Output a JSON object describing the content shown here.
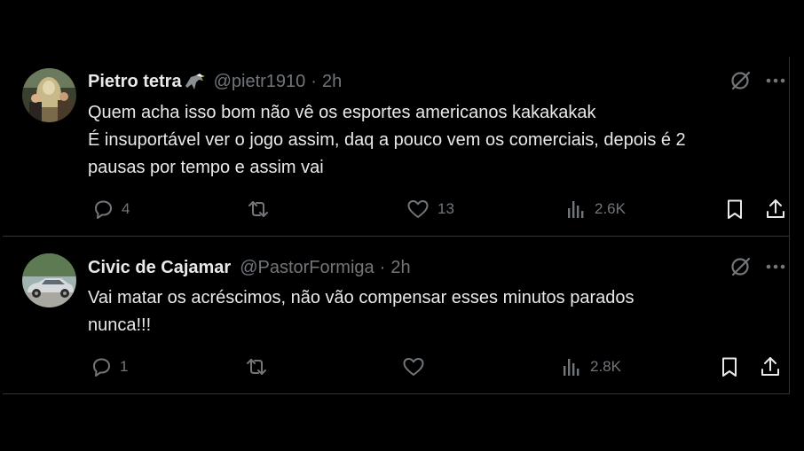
{
  "tweets": [
    {
      "display_name": "Pietro tetra",
      "name_emoji": "eagle-emoji",
      "handle": "@pietr1910",
      "separator": "·",
      "time": "2h",
      "text_lines": [
        "Quem acha isso bom não vê os esportes americanos kakakakak",
        "É insuportável ver o jogo assim, daq a pouco vem os comerciais, depois é 2",
        "pausas por tempo e assim vai"
      ],
      "stats": {
        "replies": "4",
        "retweets": "",
        "likes": "13",
        "views": "2.6K"
      }
    },
    {
      "display_name": "Civic de Cajamar",
      "handle": "@PastorFormiga",
      "separator": "·",
      "time": "2h",
      "text_lines": [
        "Vai matar os acréscimos, não vão compensar esses minutos parados",
        "nunca!!!"
      ],
      "stats": {
        "replies": "1",
        "retweets": "",
        "likes": "",
        "views": "2.8K"
      }
    }
  ],
  "icons": {
    "reply": "speech-bubble-icon",
    "retweet": "retweet-arrows-icon",
    "like": "heart-icon",
    "views": "bar-chart-icon",
    "bookmark": "bookmark-icon",
    "share": "share-upload-icon",
    "grok": "grok-slash-circle-icon",
    "more": "more-dots-icon"
  },
  "colors": {
    "background": "#000000",
    "text_primary": "#e7e9ea",
    "text_secondary": "#71767b",
    "divider": "#2f3336"
  }
}
